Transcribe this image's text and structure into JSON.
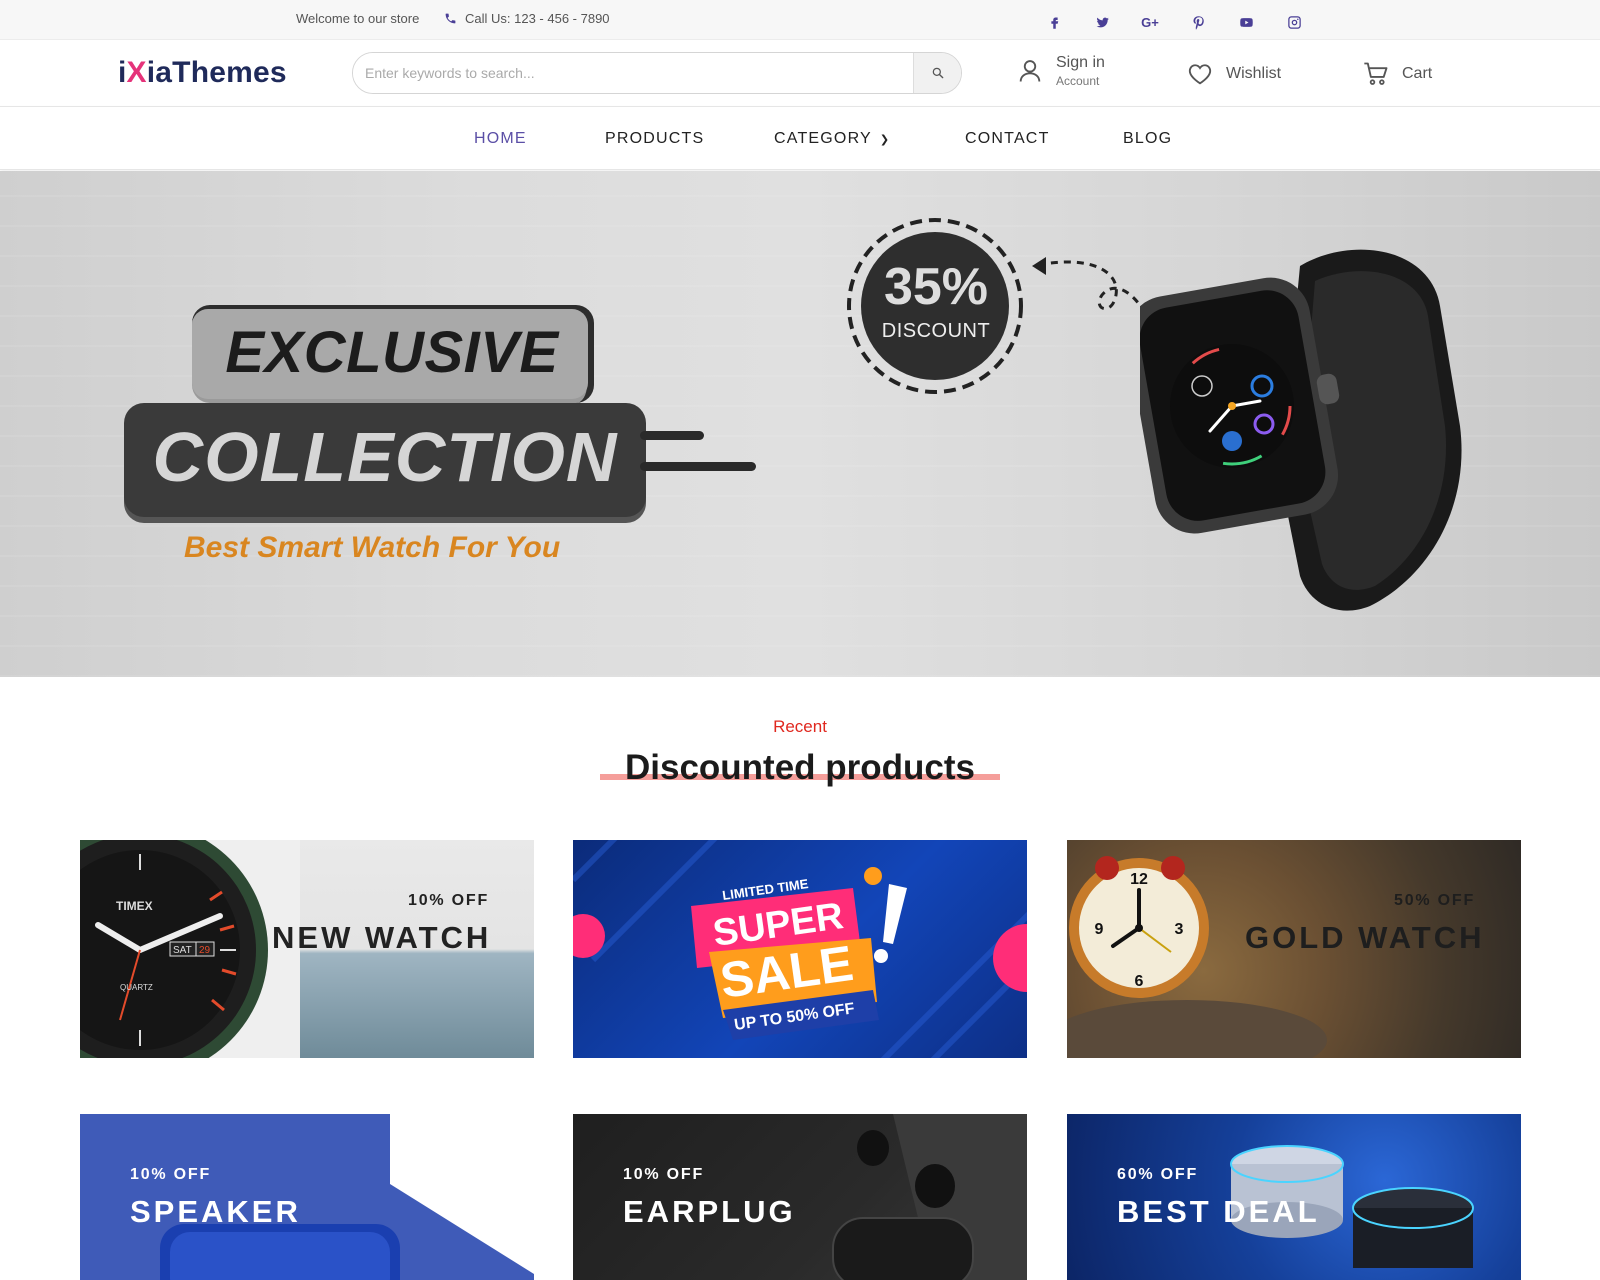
{
  "topbar": {
    "welcome": "Welcome to our store",
    "phone": "Call Us: 123 - 456 - 7890",
    "socials": [
      "facebook-icon",
      "twitter-icon",
      "google-plus-icon",
      "pinterest-icon",
      "youtube-icon",
      "instagram-icon"
    ],
    "gplus_label": "G+"
  },
  "header": {
    "logo_prefix": "i",
    "logo_x": "X",
    "logo_rest": "iaThemes",
    "search_placeholder": "Enter keywords to search...",
    "signin_title": "Sign in",
    "signin_sub": "Account",
    "wishlist": "Wishlist",
    "cart": "Cart"
  },
  "nav": {
    "home": "HOME",
    "products": "PRODUCTS",
    "category": "CATEGORY",
    "contact": "CONTACT",
    "blog": "BLOG"
  },
  "hero": {
    "exclusive": "EXCLUSIVE",
    "collection": "COLLECTION",
    "tagline": "Best Smart Watch For You",
    "discount_pct": "35%",
    "discount_label": "DISCOUNT"
  },
  "section": {
    "subtitle": "Recent",
    "title": "Discounted products"
  },
  "cards": [
    {
      "off": "10% OFF",
      "title": "NEW WATCH"
    },
    {
      "limited": "LIMITED TIME",
      "super": "SUPER",
      "sale": "SALE",
      "upto": "UP TO 50% OFF"
    },
    {
      "off": "50% OFF",
      "title": "GOLD WATCH"
    },
    {
      "off": "10% OFF",
      "title": "SPEAKER"
    },
    {
      "off": "10% OFF",
      "title": "EARPLUG"
    },
    {
      "off": "60% OFF",
      "title": "BEST DEAL"
    }
  ],
  "watch_face": {
    "brand": "TIMEX",
    "day": "SAT",
    "date": "29",
    "movement": "QUARTZ"
  },
  "colors": {
    "accent": "#5b4fa6",
    "brand_pink": "#e5337a",
    "logo_navy": "#1f2a5a",
    "recent_red": "#e0281f",
    "tagline_orange": "#d98620"
  }
}
